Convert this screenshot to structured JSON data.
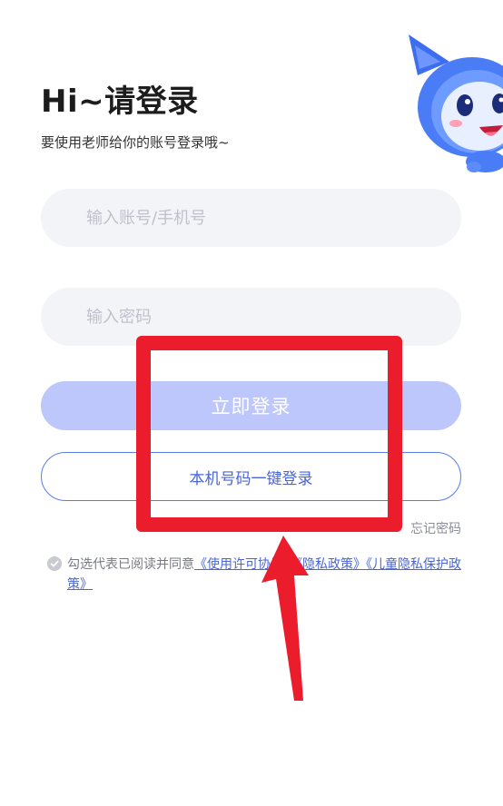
{
  "header": {
    "title": "Hi~请登录",
    "subtitle": "要使用老师给你的账号登录哦~"
  },
  "form": {
    "account_placeholder": "输入账号/手机号",
    "password_placeholder": "输入密码",
    "login_label": "立即登录",
    "phone_login_label": "本机号码一键登录",
    "forgot_label": "忘记密码"
  },
  "agreement": {
    "prefix": "勾选代表已阅读并同意",
    "license": "《使用许可协议》",
    "privacy": "《隐私政策》",
    "children_privacy": "《儿童隐私保护政策》"
  },
  "colors": {
    "primary": "#5b7be8",
    "login_button_bg": "#bdc7fb",
    "input_bg": "#f3f4f8",
    "annotation_red": "#eb1c2c"
  },
  "icons": {
    "mascot": "blue-cat-mascot",
    "agree_check": "check-circle-icon"
  }
}
